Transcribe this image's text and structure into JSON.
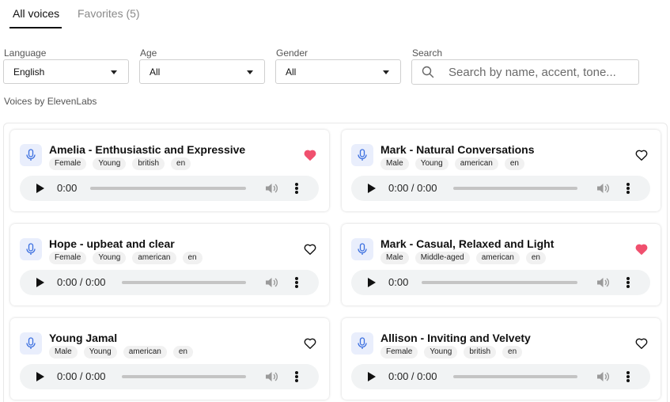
{
  "tabs": [
    {
      "label": "All voices"
    },
    {
      "label": "Favorites (5)"
    }
  ],
  "filters": {
    "language": {
      "label": "Language",
      "value": "English"
    },
    "age": {
      "label": "Age",
      "value": "All"
    },
    "gender": {
      "label": "Gender",
      "value": "All"
    },
    "search": {
      "label": "Search",
      "placeholder": "Search by name, accent, tone..."
    }
  },
  "section_label": "Voices by ElevenLabs",
  "voices": [
    {
      "name": "Amelia - Enthusiastic and Expressive",
      "tags": [
        "Female",
        "Young",
        "british",
        "en"
      ],
      "favorite": true,
      "time": "0:00"
    },
    {
      "name": "Mark - Natural Conversations",
      "tags": [
        "Male",
        "Young",
        "american",
        "en"
      ],
      "favorite": false,
      "time": "0:00 / 0:00"
    },
    {
      "name": "Hope - upbeat and clear",
      "tags": [
        "Female",
        "Young",
        "american",
        "en"
      ],
      "favorite": false,
      "time": "0:00 / 0:00"
    },
    {
      "name": "Mark - Casual, Relaxed and Light",
      "tags": [
        "Male",
        "Middle-aged",
        "american",
        "en"
      ],
      "favorite": true,
      "time": "0:00"
    },
    {
      "name": "Young Jamal",
      "tags": [
        "Male",
        "Young",
        "american",
        "en"
      ],
      "favorite": false,
      "time": "0:00 / 0:00"
    },
    {
      "name": "Allison - Inviting and Velvety",
      "tags": [
        "Female",
        "Young",
        "british",
        "en"
      ],
      "favorite": false,
      "time": "0:00 / 0:00"
    }
  ],
  "colors": {
    "favorite": "#f0506e",
    "accent": "#3b6fe0",
    "mic_bg": "#e9eefc"
  },
  "icons": {
    "mic": "microphone-icon",
    "heart": "heart-icon",
    "search": "search-icon",
    "play": "play-icon",
    "volume": "volume-icon",
    "menu": "more-vertical-icon"
  }
}
